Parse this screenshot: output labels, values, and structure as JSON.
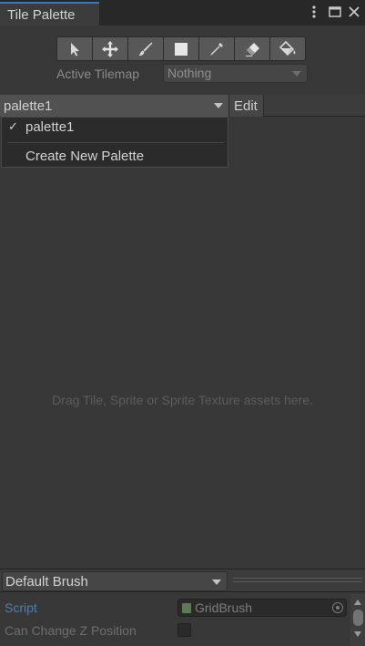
{
  "window": {
    "tab_title": "Tile Palette",
    "menu_icon": "kebab-menu-icon",
    "maximize_icon": "maximize-icon",
    "close_icon": "close-icon"
  },
  "toolbar": {
    "tools": [
      "select-tool-icon",
      "move-tool-icon",
      "paint-brush-icon",
      "box-fill-icon",
      "picker-icon",
      "eraser-icon",
      "flood-fill-icon"
    ]
  },
  "active_tilemap": {
    "label": "Active Tilemap",
    "value": "Nothing"
  },
  "palette": {
    "selected": "palette1",
    "edit_label": "Edit",
    "menu": {
      "items": [
        {
          "check": "✓",
          "label": "palette1"
        },
        {
          "check": "",
          "label": "Create New Palette"
        }
      ]
    }
  },
  "drop_hint": "Drag Tile, Sprite or Sprite Texture assets here.",
  "brush": {
    "selected": "Default Brush",
    "script_label": "Script",
    "script_value": "GridBrush",
    "can_change_z_label": "Can Change Z Position",
    "can_change_z_value": false
  },
  "colors": {
    "accent": "#3a79bb",
    "background": "#383838"
  }
}
